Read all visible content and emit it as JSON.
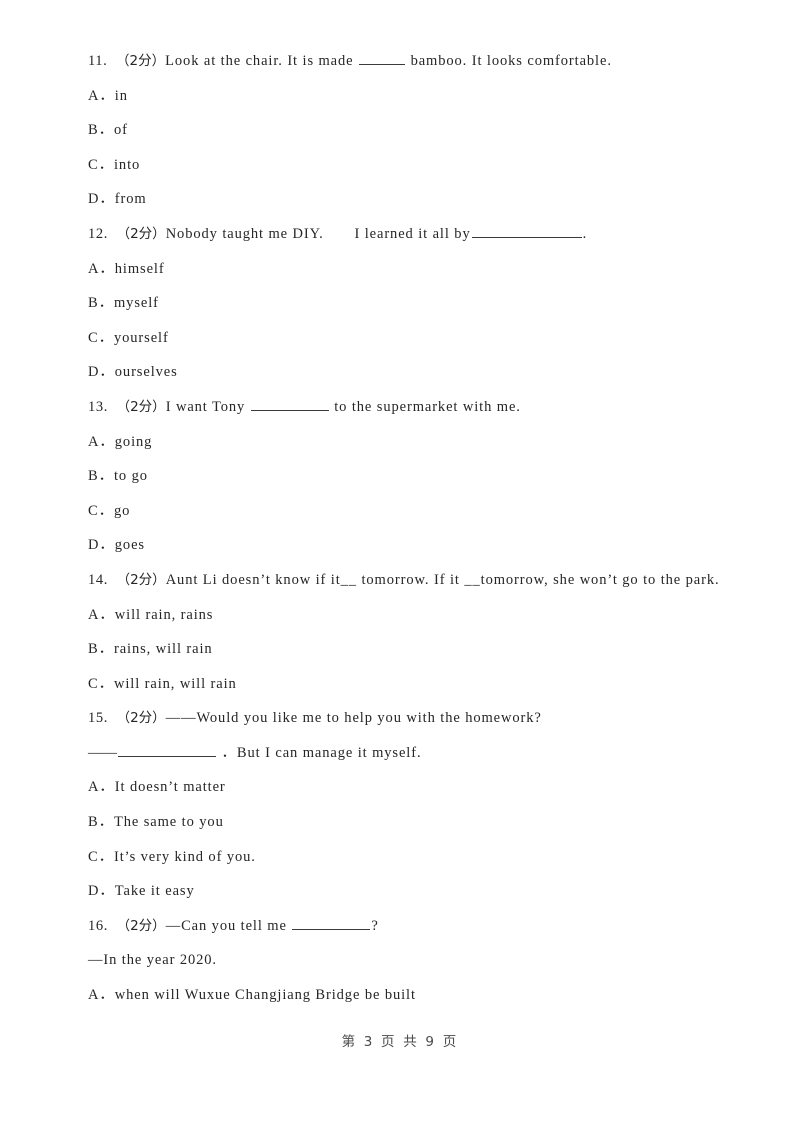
{
  "document": {
    "type": "exam-worksheet",
    "language": "en-with-zh-annotations",
    "page_background": "#ffffff",
    "text_color": "#262626"
  },
  "questions": [
    {
      "number": "11.",
      "marks": "（2分）",
      "stem_before": "Look at the chair. It is made ",
      "blank": "sm",
      "stem_after": " bamboo. It looks comfortable.",
      "options": [
        {
          "label": "A．",
          "text": "in"
        },
        {
          "label": "B．",
          "text": "of"
        },
        {
          "label": "C．",
          "text": "into"
        },
        {
          "label": "D．",
          "text": "from"
        }
      ]
    },
    {
      "number": "12.",
      "marks": "（2分）",
      "stem_before": "Nobody taught me DIY.　　I learned it all by",
      "blank": "xxl",
      "stem_after": ".",
      "options": [
        {
          "label": "A．",
          "text": "himself"
        },
        {
          "label": "B．",
          "text": "myself"
        },
        {
          "label": "C．",
          "text": "yourself"
        },
        {
          "label": "D．",
          "text": "ourselves"
        }
      ]
    },
    {
      "number": "13.",
      "marks": "（2分）",
      "stem_before": "I want Tony ",
      "blank": "lg",
      "stem_after": " to the supermarket with me.",
      "options": [
        {
          "label": "A．",
          "text": "going"
        },
        {
          "label": "B．",
          "text": "to go"
        },
        {
          "label": "C．",
          "text": "go"
        },
        {
          "label": "D．",
          "text": "goes"
        }
      ]
    },
    {
      "number": "14.",
      "marks": "（2分）",
      "stem_full": "Aunt Li doesn’t know if it__ tomorrow. If it __tomorrow, she won’t go to the park.",
      "options": [
        {
          "label": "A．",
          "text": "will rain, rains"
        },
        {
          "label": "B．",
          "text": "rains, will rain"
        },
        {
          "label": "C．",
          "text": "will rain, will rain"
        }
      ]
    },
    {
      "number": "15.",
      "marks": "（2分）",
      "stem_before": "——Would you like me to help you with the homework?",
      "answer_dash": "——",
      "blank": "xl",
      "answer_after": " ．But I can manage it myself.",
      "options": [
        {
          "label": "A．",
          "text": "It doesn’t matter"
        },
        {
          "label": "B．",
          "text": "The same to you"
        },
        {
          "label": "C．",
          "text": "It’s very kind of you."
        },
        {
          "label": "D．",
          "text": "Take it easy"
        }
      ]
    },
    {
      "number": "16.",
      "marks": "（2分）",
      "stem_before": "—Can you tell me ",
      "blank": "lg",
      "stem_after": "?",
      "answer_line": "—In the year 2020.",
      "options": [
        {
          "label": "A．",
          "text": "when will Wuxue Changjiang Bridge be built"
        }
      ]
    }
  ],
  "footer": {
    "text": "第 3 页 共 9 页",
    "current_page": "3",
    "total_pages": "9"
  }
}
